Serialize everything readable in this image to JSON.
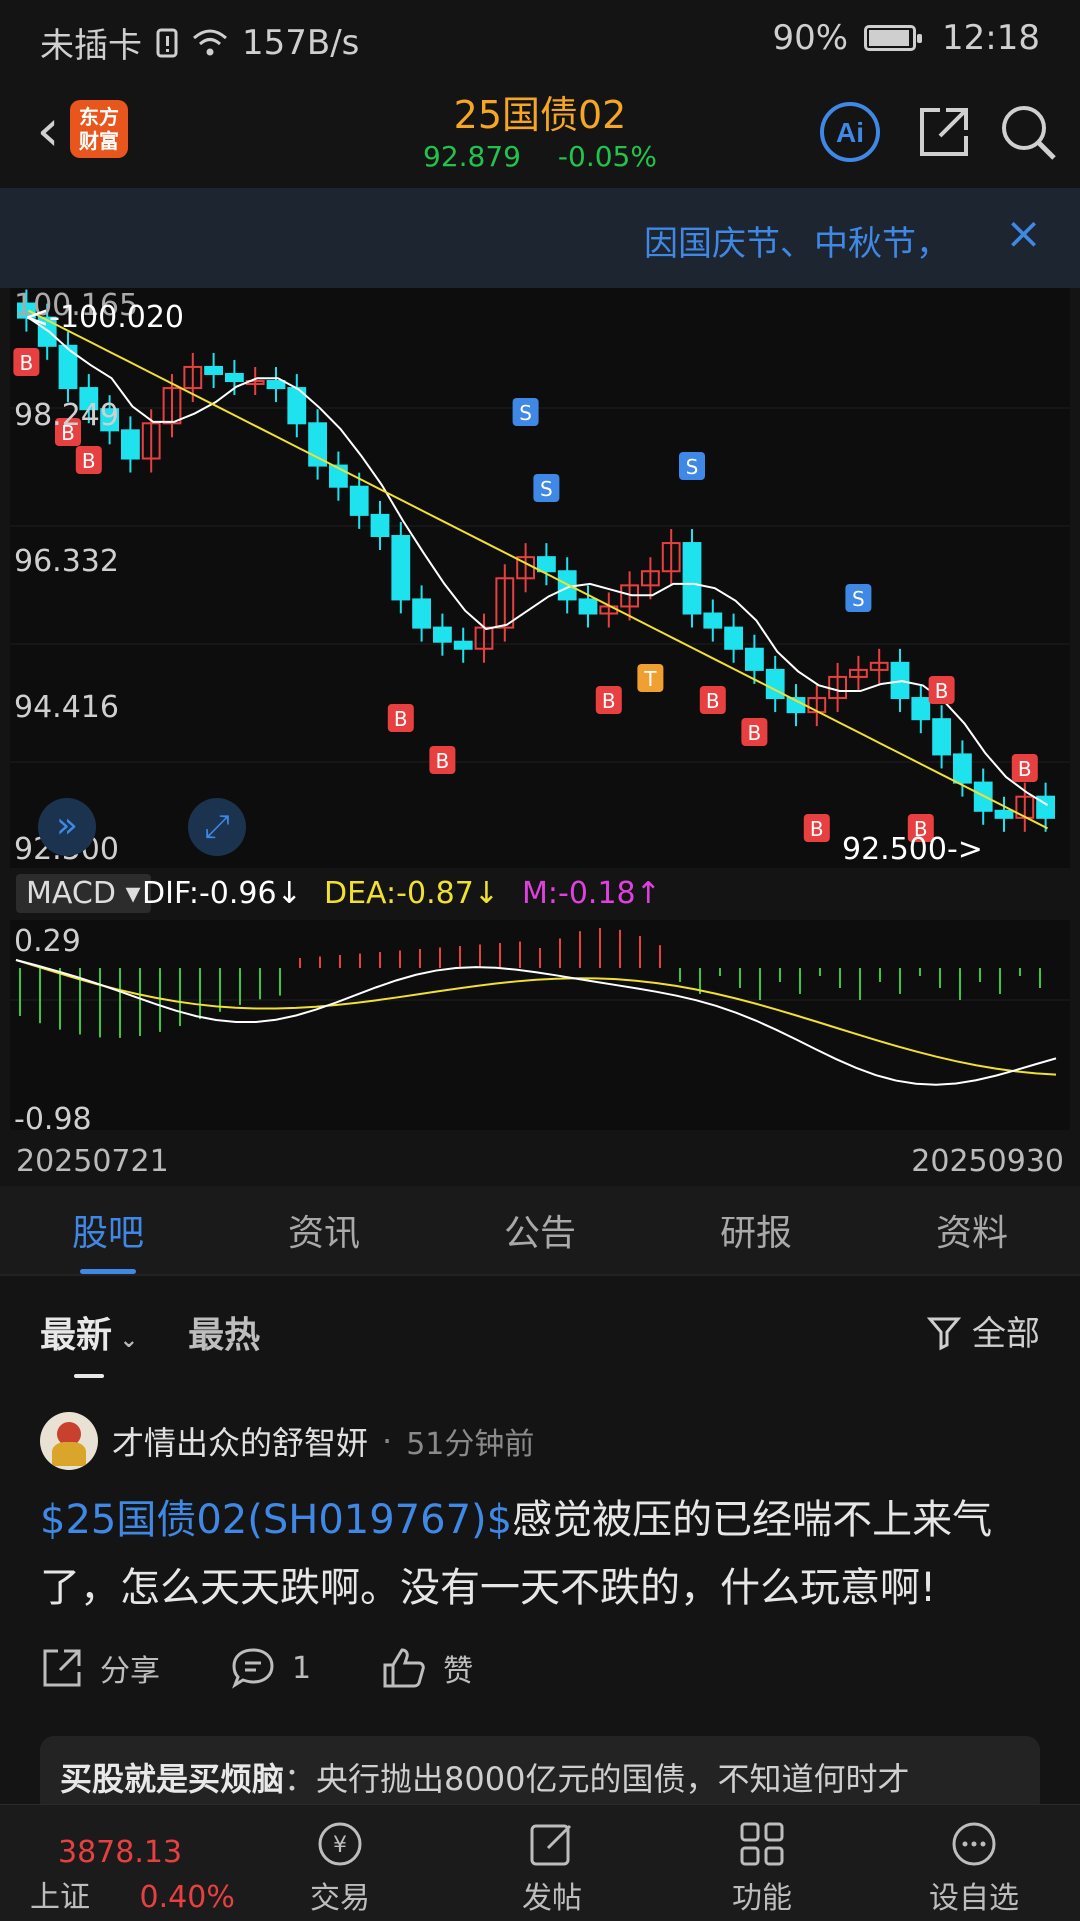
{
  "status_bar": {
    "carrier": "未插卡",
    "net_speed": "157B/s",
    "battery": "90%",
    "time": "12:18"
  },
  "header": {
    "logo_text": "东方财富",
    "title": "25国债02",
    "price": "92.879",
    "change": "-0.05%"
  },
  "notice": {
    "text": "因国庆节、中秋节，"
  },
  "kline": {
    "price_labels": [
      "100.165",
      "98.249",
      "96.332",
      "94.416",
      "92.500"
    ],
    "max_marker": "<-100.020",
    "min_marker": "92.500->",
    "signal_labels": {
      "buy": "B",
      "sell": "S",
      "t": "T"
    }
  },
  "macd": {
    "tag": "MACD",
    "dif": "DIF:-0.96",
    "dea": "DEA:-0.87",
    "m": "M:-0.18",
    "top_label": "0.29",
    "bottom_label": "-0.98"
  },
  "dates": {
    "start": "20250721",
    "end": "20250930"
  },
  "tabs": [
    "股吧",
    "资讯",
    "公告",
    "研报",
    "资料"
  ],
  "feed": {
    "sort_new": "最新",
    "sort_hot": "最热",
    "filter": "全部",
    "post": {
      "author": "才情出众的舒智妍",
      "time": "51分钟前",
      "link": "$25国债02(SH019767)$",
      "text": "感觉被压的已经喘不上来气了，怎么天天跌啊。没有一天不跌的，什么玩意啊!",
      "share": "分享",
      "comments": "1",
      "like": "赞"
    },
    "quote": {
      "title": "买股就是买烦脑",
      "text": "：央行抛出8000亿元的国债，不知道何时才"
    }
  },
  "bottom": {
    "index_value": "3878.13",
    "index_name": "上证",
    "index_change": "0.40%",
    "nav": [
      "交易",
      "发帖",
      "功能",
      "设自选"
    ]
  },
  "colors": {
    "up": "#e84040",
    "down": "#1ee3ef",
    "accent": "#3f88e5",
    "price_title": "#f5a623",
    "green": "#22c34a"
  }
}
